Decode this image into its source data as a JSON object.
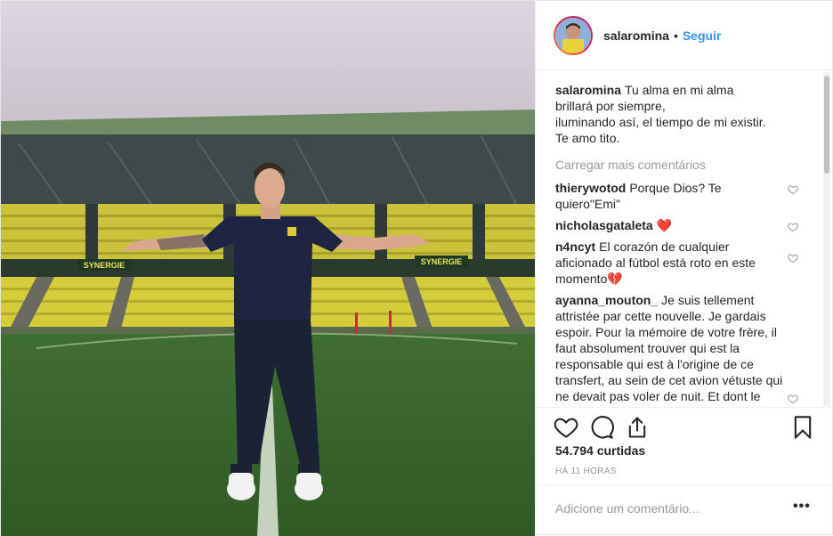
{
  "photo": {
    "stadium_sign_left": "SYNERGIE",
    "stadium_sign_right": "SYNERGIE"
  },
  "header": {
    "username": "salaromina",
    "separator": "•",
    "follow_label": "Seguir"
  },
  "caption": {
    "username": "salaromina",
    "lines": [
      "Tu alma en mi alma",
      "brillará por siempre,",
      "iluminando así, el tiempo de mi existir.",
      "Te amo tito."
    ]
  },
  "load_more_label": "Carregar mais comentários",
  "comments": [
    {
      "username": "thierywotod",
      "text": "Porque Dios? Te quiero\"Emi\""
    },
    {
      "username": "nicholasgataleta",
      "text": "",
      "emoji": "❤️"
    },
    {
      "username": "n4ncyt",
      "text": "El corazón de cualquier aficionado al fútbol está roto en este momento",
      "emoji": "💔"
    },
    {
      "username": "ayanna_mouton_",
      "text": "Je suis tellement attristée par cette nouvelle. Je gardais espoir. Pour la mémoire de votre frère, il faut absolument trouver qui est la responsable qui est à l'origine de ce transfert, au sein de cet avion vétuste qui ne devait pas voler de nuit. Et dont le conducteur n'était pas celui"
    }
  ],
  "likes_label": "54.794 curtidas",
  "time_label": "HÁ 11 HORAS",
  "add_comment": {
    "placeholder": "Adicione um comentário..."
  },
  "more_label": "•••",
  "icons": {
    "like": "heart-icon",
    "comment": "comment-icon",
    "share": "share-icon",
    "save": "bookmark-icon"
  },
  "colors": {
    "accent": "#3897f0",
    "muted": "#999999",
    "text": "#262626",
    "heart": "#e0245e"
  }
}
